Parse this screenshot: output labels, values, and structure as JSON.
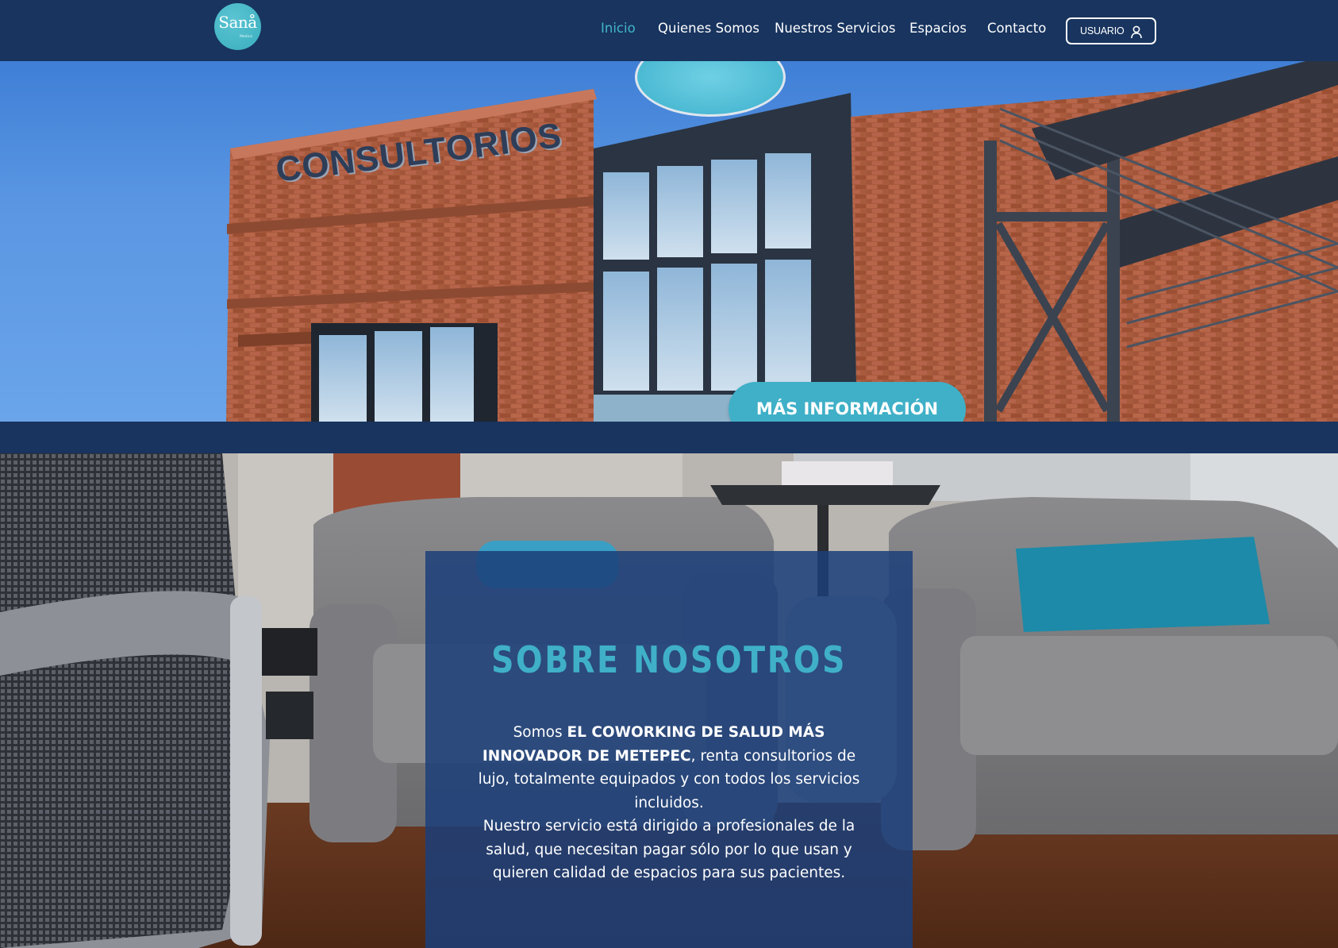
{
  "header": {
    "logo": {
      "name": "Sanå",
      "tagline": "Medica"
    },
    "nav": [
      {
        "label": "Inicio",
        "active": true
      },
      {
        "label": "Quienes Somos",
        "active": false
      },
      {
        "label": "Nuestros Servicios",
        "active": false
      },
      {
        "label": "Espacios",
        "active": false
      },
      {
        "label": "Contacto",
        "active": false
      }
    ],
    "user_button": {
      "label": "USUARIO",
      "icon": "user-icon"
    }
  },
  "hero": {
    "sign_text": "CONSULTORIOS",
    "cta_label": "MÁS INFORMACIÓN"
  },
  "about": {
    "title": "SOBRE NOSOTROS",
    "p1_prefix": "Somos ",
    "p1_bold": "EL COWORKING DE SALUD MÁS INNOVADOR DE METEPEC",
    "p1_suffix": ", renta consultorios de lujo, totalmente equipados y con todos los servicios incluidos.",
    "p2": "Nuestro servicio está dirigido a profesionales de la salud, que necesitan pagar sólo por lo que usan y quieren calidad de espacios para sus pacientes."
  },
  "colors": {
    "navy": "#18345f",
    "accent": "#3fb0c7",
    "panel": "#1c3f79"
  }
}
